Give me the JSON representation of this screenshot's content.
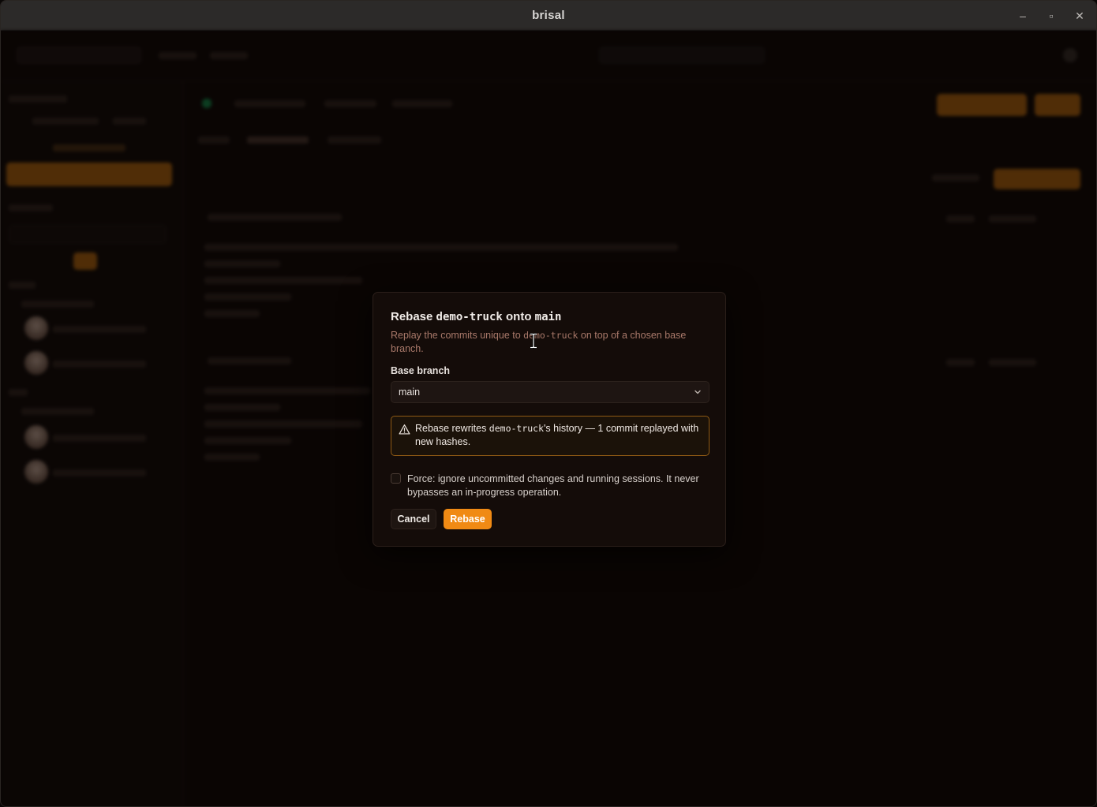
{
  "window": {
    "title": "brisal",
    "controls": {
      "minimize": "–",
      "maximize": "▫",
      "close": "✕"
    }
  },
  "dialog": {
    "title_prefix": "Rebase ",
    "title_branch": "demo-truck",
    "title_mid": " onto ",
    "title_target": "main",
    "description_before": "Replay the commits unique to ",
    "description_branch": "demo-truck",
    "description_after": " on top of a chosen base branch.",
    "base_branch_label": "Base branch",
    "base_branch_value": "main",
    "warning_before": "Rebase rewrites ",
    "warning_branch": "demo-truck",
    "warning_after": "'s history — 1 commit replayed with new hashes.",
    "force_label": "Force: ignore uncommitted changes and running sessions. It never bypasses an in-progress operation.",
    "force_checked": false,
    "cancel_label": "Cancel",
    "rebase_label": "Rebase",
    "accent_color": "#f08a14",
    "warning_border_color": "#8f5a14"
  },
  "icons": {
    "select_chevron": "chevron-down-icon",
    "warning": "warning-triangle-icon",
    "cursor": "text-cursor-icon"
  }
}
